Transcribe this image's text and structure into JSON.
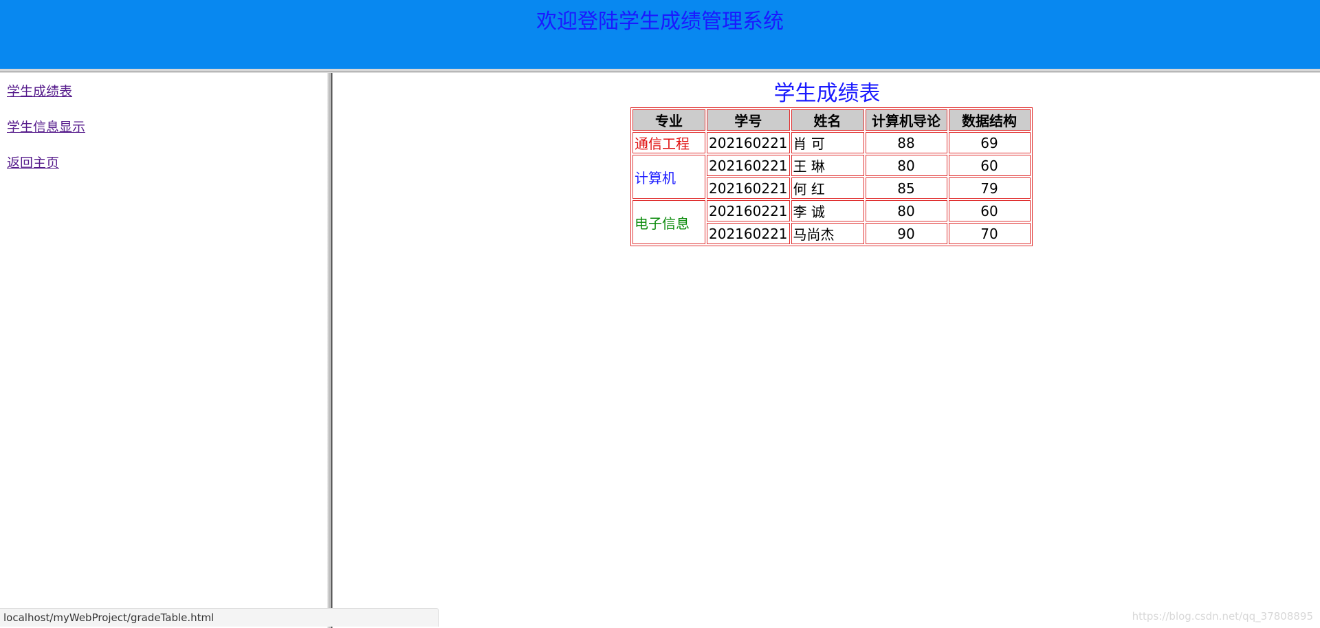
{
  "header": {
    "title": "欢迎登陆学生成绩管理系统"
  },
  "sidebar": {
    "links": [
      {
        "label": "学生成绩表"
      },
      {
        "label": "学生信息显示"
      },
      {
        "label": "返回主页"
      }
    ]
  },
  "main": {
    "title": "学生成绩表",
    "table": {
      "headers": [
        "专业",
        "学号",
        "姓名",
        "计算机导论",
        "数据结构"
      ],
      "groups": [
        {
          "major": "通信工程",
          "color": "#e01010",
          "rows": [
            {
              "id": "202160221",
              "name": "肖 可",
              "s1": "88",
              "s2": "69"
            }
          ]
        },
        {
          "major": "计算机",
          "color": "#1a1aff",
          "rows": [
            {
              "id": "202160221",
              "name": "王 琳",
              "s1": "80",
              "s2": "60"
            },
            {
              "id": "202160221",
              "name": "何 红",
              "s1": "85",
              "s2": "79"
            }
          ]
        },
        {
          "major": "电子信息",
          "color": "#0a8a0a",
          "rows": [
            {
              "id": "202160221",
              "name": "李 诚",
              "s1": "80",
              "s2": "60"
            },
            {
              "id": "202160221",
              "name": "马尚杰",
              "s1": "90",
              "s2": "70"
            }
          ]
        }
      ],
      "border_color": "#e03030",
      "header_bg": "#cccccc"
    }
  },
  "status_bar": {
    "url": "localhost/myWebProject/gradeTable.html"
  },
  "watermark": {
    "text": "https://blog.csdn.net/qq_37808895"
  },
  "colors": {
    "header_bg": "#0888f0",
    "title_color": "#1a1aff",
    "link_visited": "#551a8b"
  }
}
